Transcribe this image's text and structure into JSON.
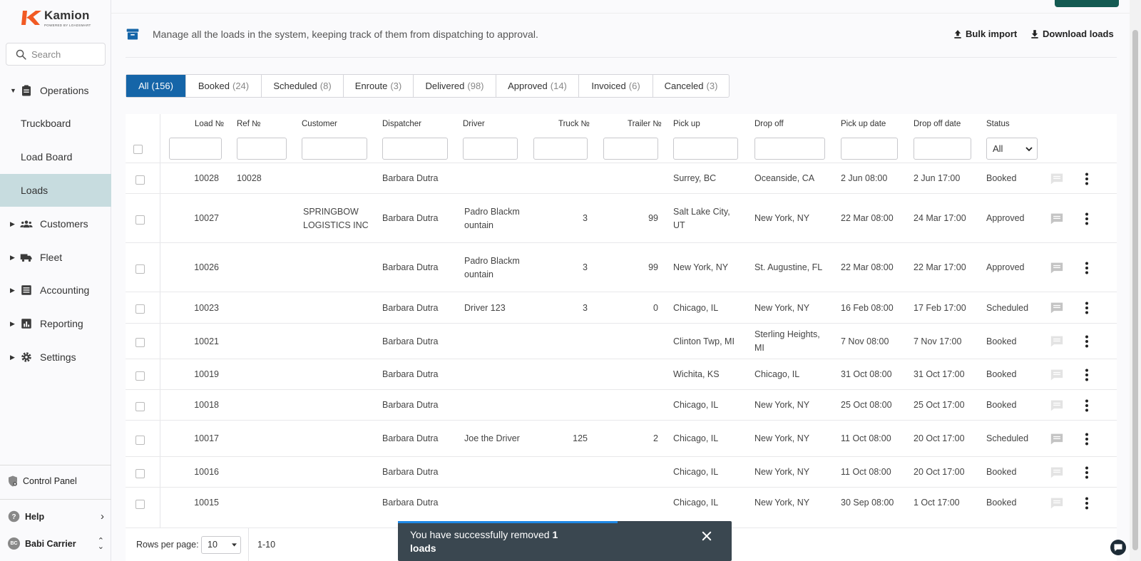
{
  "brand": {
    "name": "Kamion",
    "tagline": "POWERED BY LOADSMART",
    "accent": "#f15a24"
  },
  "search": {
    "placeholder": "Search"
  },
  "nav": {
    "operations": "Operations",
    "items": [
      {
        "label": "Truckboard"
      },
      {
        "label": "Load Board"
      },
      {
        "label": "Loads"
      }
    ],
    "customers": "Customers",
    "fleet": "Fleet",
    "accounting": "Accounting",
    "reporting": "Reporting",
    "settings": "Settings"
  },
  "footer": {
    "control_panel": "Control Panel",
    "help": "Help",
    "user": "Babi Carrier",
    "user_initials": "BC"
  },
  "page": {
    "description": "Manage all the loads in the system, keeping track of them from dispatching to approval.",
    "bulk_import": "Bulk import",
    "download": "Download loads"
  },
  "tabs": [
    {
      "label": "All",
      "count": "(156)"
    },
    {
      "label": "Booked",
      "count": "(24)"
    },
    {
      "label": "Scheduled",
      "count": "(8)"
    },
    {
      "label": "Enroute",
      "count": "(3)"
    },
    {
      "label": "Delivered",
      "count": "(98)"
    },
    {
      "label": "Approved",
      "count": "(14)"
    },
    {
      "label": "Invoiced",
      "count": "(6)"
    },
    {
      "label": "Canceled",
      "count": "(3)"
    }
  ],
  "columns": {
    "load": "Load №",
    "ref": "Ref №",
    "customer": "Customer",
    "dispatcher": "Dispatcher",
    "driver": "Driver",
    "truck": "Truck №",
    "trailer": "Trailer №",
    "pickup": "Pick up",
    "dropoff": "Drop off",
    "pickup_date": "Pick up date",
    "dropoff_date": "Drop off date",
    "status": "Status"
  },
  "status_filter": "All",
  "rows": [
    {
      "load": "10028",
      "ref": "10028",
      "customer": "",
      "dispatcher": "Barbara Dutra",
      "driver": "",
      "truck": "",
      "trailer": "",
      "pickup": "Surrey, BC",
      "dropoff": "Oceanside, CA",
      "pickup_date": "2 Jun 08:00",
      "dropoff_date": "2 Jun 17:00",
      "status": "Booked"
    },
    {
      "load": "10027",
      "ref": "",
      "customer": "SPRINGBOW LOGISTICS INC",
      "dispatcher": "Barbara Dutra",
      "driver": "Padro Blackmountain",
      "truck": "3",
      "trailer": "99",
      "pickup": "Salt Lake City, UT",
      "dropoff": "New York, NY",
      "pickup_date": "22 Mar 08:00",
      "dropoff_date": "24 Mar 17:00",
      "status": "Approved"
    },
    {
      "load": "10026",
      "ref": "",
      "customer": "",
      "dispatcher": "Barbara Dutra",
      "driver": "Padro Blackmountain",
      "truck": "3",
      "trailer": "99",
      "pickup": "New York, NY",
      "dropoff": "St. Augustine, FL",
      "pickup_date": "22 Mar 08:00",
      "dropoff_date": "22 Mar 17:00",
      "status": "Approved"
    },
    {
      "load": "10023",
      "ref": "",
      "customer": "",
      "dispatcher": "Barbara Dutra",
      "driver": "Driver 123",
      "truck": "3",
      "trailer": "0",
      "pickup": "Chicago, IL",
      "dropoff": "New York, NY",
      "pickup_date": "16 Feb 08:00",
      "dropoff_date": "17 Feb 17:00",
      "status": "Scheduled"
    },
    {
      "load": "10021",
      "ref": "",
      "customer": "",
      "dispatcher": "Barbara Dutra",
      "driver": "",
      "truck": "",
      "trailer": "",
      "pickup": "Clinton Twp, MI",
      "dropoff": "Sterling Heights, MI",
      "pickup_date": "7 Nov 08:00",
      "dropoff_date": "7 Nov 17:00",
      "status": "Booked"
    },
    {
      "load": "10019",
      "ref": "",
      "customer": "",
      "dispatcher": "Barbara Dutra",
      "driver": "",
      "truck": "",
      "trailer": "",
      "pickup": "Wichita, KS",
      "dropoff": "Chicago, IL",
      "pickup_date": "31 Oct 08:00",
      "dropoff_date": "31 Oct 17:00",
      "status": "Booked"
    },
    {
      "load": "10018",
      "ref": "",
      "customer": "",
      "dispatcher": "Barbara Dutra",
      "driver": "",
      "truck": "",
      "trailer": "",
      "pickup": "Chicago, IL",
      "dropoff": "New York, NY",
      "pickup_date": "25 Oct 08:00",
      "dropoff_date": "25 Oct 17:00",
      "status": "Booked"
    },
    {
      "load": "10017",
      "ref": "",
      "customer": "",
      "dispatcher": "Barbara Dutra",
      "driver": "Joe the Driver",
      "truck": "125",
      "trailer": "2",
      "pickup": "Chicago, IL",
      "dropoff": "New York, NY",
      "pickup_date": "11 Oct 08:00",
      "dropoff_date": "20 Oct 17:00",
      "status": "Scheduled"
    },
    {
      "load": "10016",
      "ref": "",
      "customer": "",
      "dispatcher": "Barbara Dutra",
      "driver": "",
      "truck": "",
      "trailer": "",
      "pickup": "Chicago, IL",
      "dropoff": "New York, NY",
      "pickup_date": "11 Oct 08:00",
      "dropoff_date": "20 Oct 17:00",
      "status": "Booked"
    },
    {
      "load": "10015",
      "ref": "",
      "customer": "",
      "dispatcher": "Barbara Dutra",
      "driver": "",
      "truck": "",
      "trailer": "",
      "pickup": "Chicago, IL",
      "dropoff": "New York, NY",
      "pickup_date": "30 Sep 08:00",
      "dropoff_date": "1 Oct 17:00",
      "status": "Booked"
    }
  ],
  "pagination": {
    "rows_label": "Rows per page:",
    "rows_value": "10",
    "range": "1-10"
  },
  "toast": {
    "message_prefix": "You have successfully removed ",
    "count": "1",
    "message_suffix": "loads"
  }
}
